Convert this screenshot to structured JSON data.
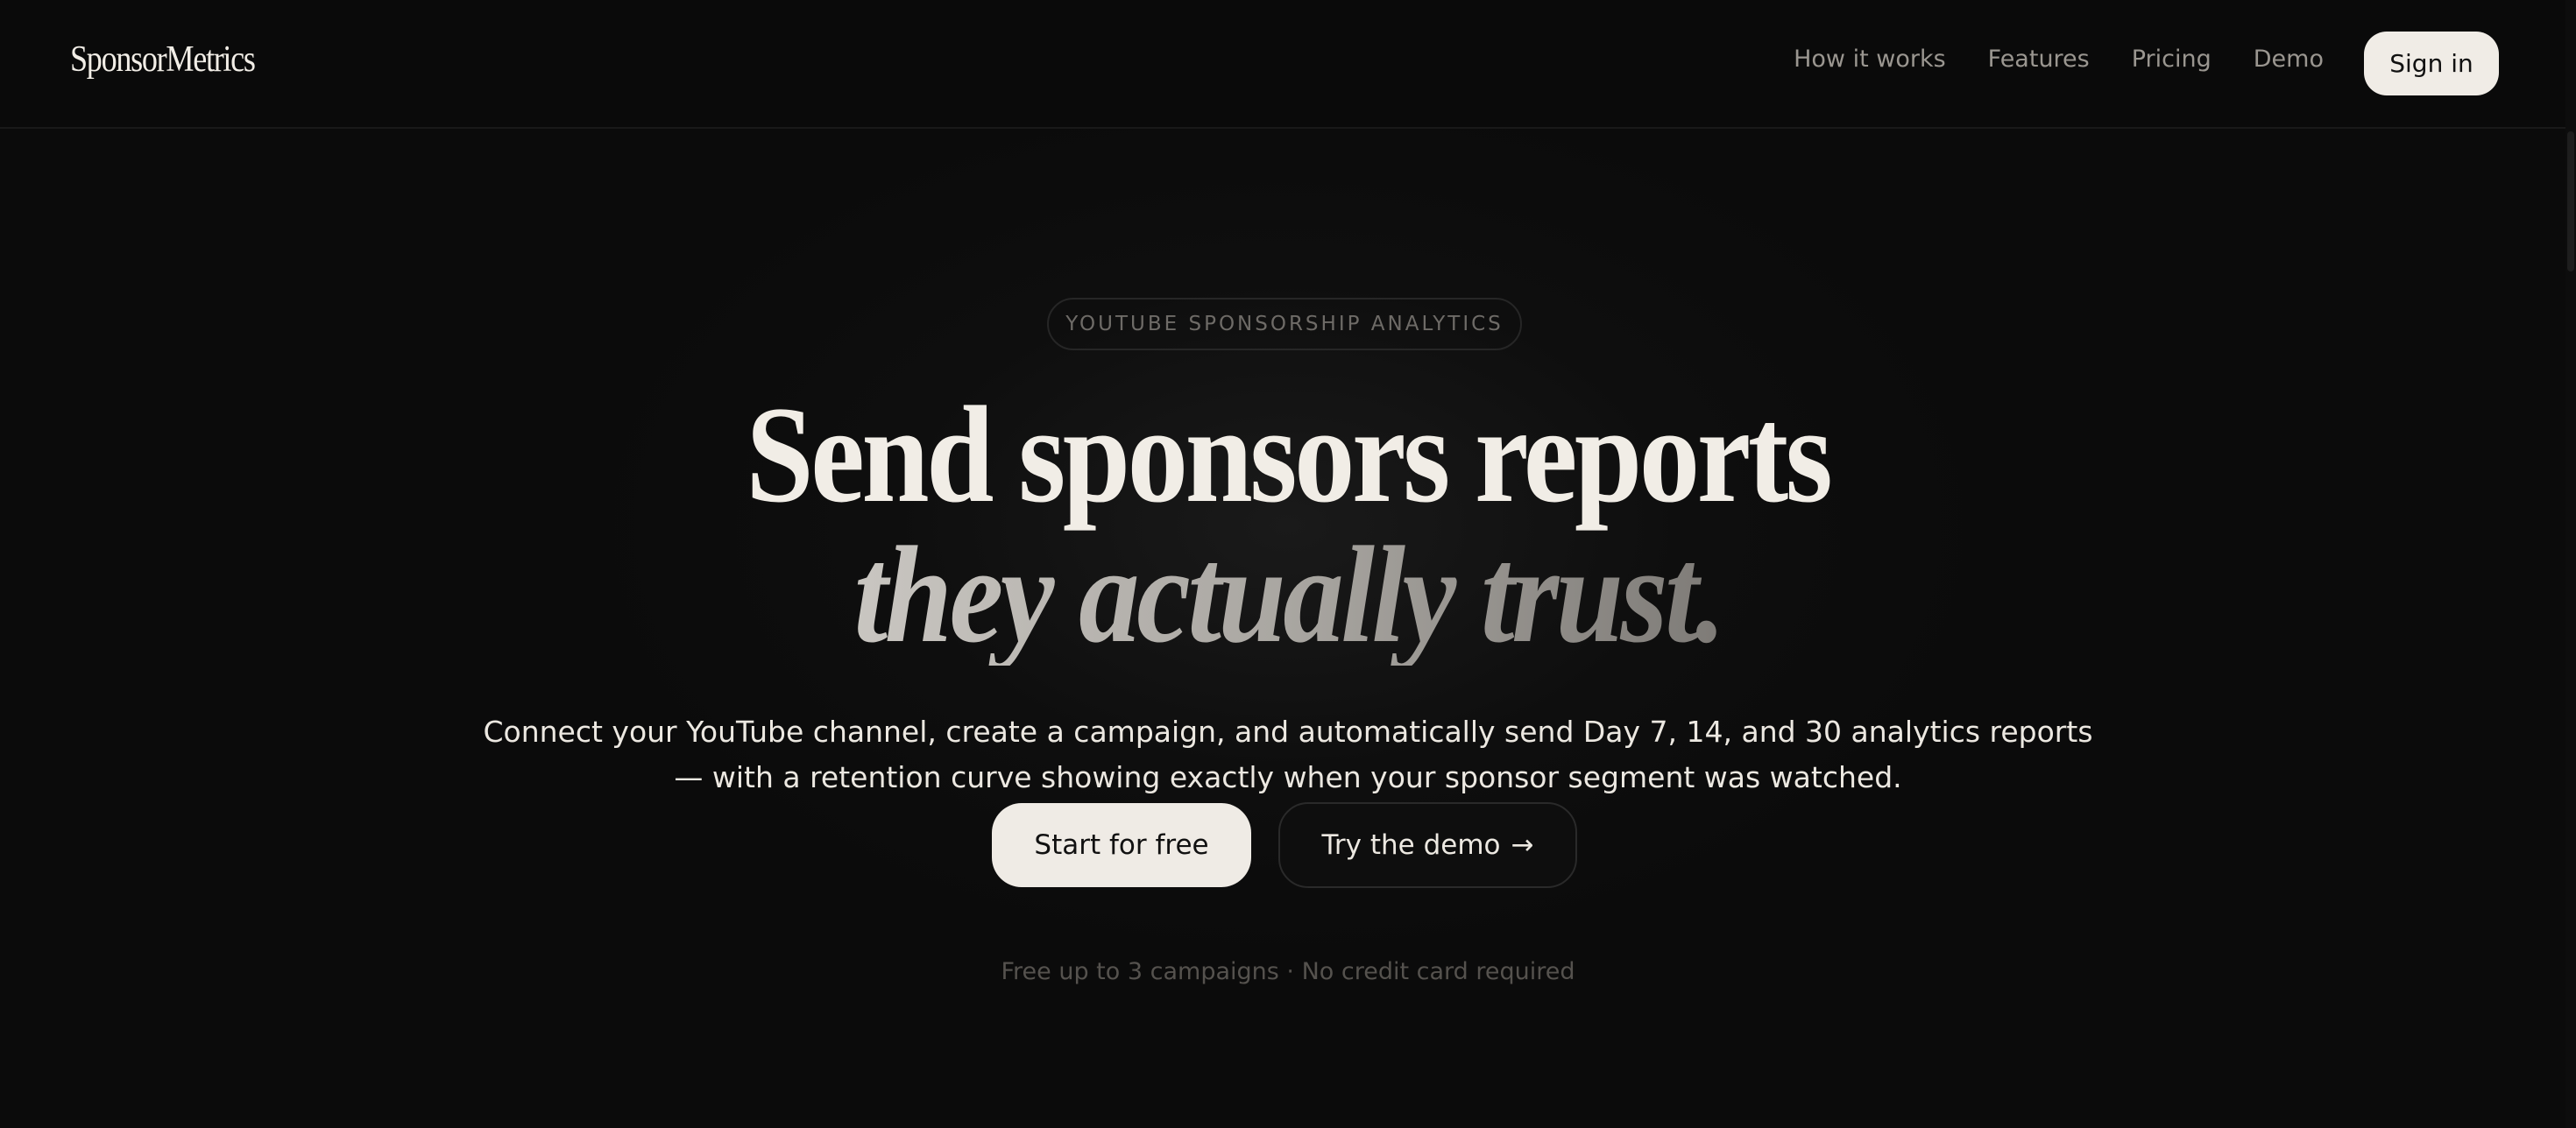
{
  "nav": {
    "logo": "SponsorMetrics",
    "links": [
      {
        "label": "How it works"
      },
      {
        "label": "Features"
      },
      {
        "label": "Pricing"
      },
      {
        "label": "Demo"
      }
    ],
    "signin_label": "Sign in"
  },
  "hero": {
    "badge": "YOUTUBE SPONSORSHIP ANALYTICS",
    "headline_line1": "Send sponsors reports",
    "headline_line2": "they actually trust.",
    "subtext_line1": "Connect your YouTube channel, create a campaign, and automatically send Day 7, 14, and 30 analytics reports",
    "subtext_line2": "— with a retention curve showing exactly when your sponsor segment was watched.",
    "primary_cta": "Start for free",
    "secondary_cta": "Try the demo",
    "secondary_cta_icon": "→",
    "footnote": "Free up to 3 campaigns · No credit card required"
  },
  "colors": {
    "background": "#0b0b0b",
    "text": "#ece8e1",
    "button_light": "#efebe5",
    "muted": "#9a9690"
  },
  "icons": {
    "secondary_cta_icon": "arrow-right-icon"
  }
}
